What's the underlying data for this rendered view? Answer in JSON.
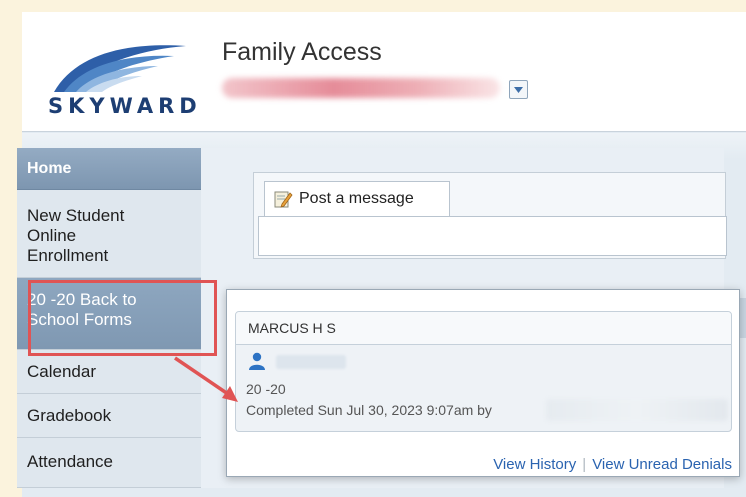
{
  "header": {
    "logo_text": "SKYWARD",
    "app_title": "Family Access"
  },
  "sidebar": {
    "items": [
      {
        "label": "Home"
      },
      {
        "label": "New Student Online Enrollment"
      },
      {
        "label": "20 -20 Back to School Forms"
      },
      {
        "label": "Calendar"
      },
      {
        "label": "Gradebook"
      },
      {
        "label": "Attendance"
      }
    ]
  },
  "message": {
    "post_label": "Post a message"
  },
  "popup": {
    "student_name": "MARCUS H S",
    "year_text": "20 -20",
    "completed_text": "Completed Sun Jul 30, 2023 9:07am by",
    "links": {
      "history": "View History",
      "unread_denials": "View Unread Denials"
    }
  },
  "colors": {
    "accent": "#7d96b0",
    "highlight": "#e05454",
    "link": "#2a63b0"
  },
  "icons": [
    "dropdown-arrow-icon",
    "edit-message-icon",
    "person-icon",
    "skyward-logo"
  ]
}
